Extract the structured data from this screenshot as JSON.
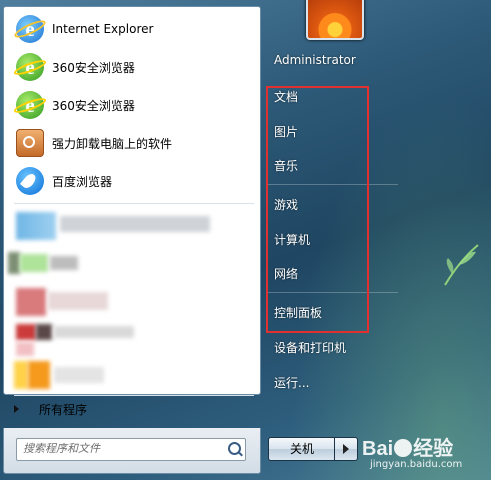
{
  "left_panel": {
    "pinned": [
      {
        "label": "Internet Explorer",
        "icon": "internet-explorer-icon"
      },
      {
        "label": "360安全浏览器",
        "icon": "360-browser-icon"
      },
      {
        "label": "360安全浏览器",
        "icon": "360-browser-icon"
      },
      {
        "label": "强力卸载电脑上的软件",
        "icon": "uninstaller-icon"
      },
      {
        "label": "百度浏览器",
        "icon": "baidu-browser-icon"
      }
    ],
    "all_programs": "所有程序",
    "search_placeholder": "搜索程序和文件"
  },
  "right_panel": {
    "user": "Administrator",
    "items": [
      "文档",
      "图片",
      "音乐",
      "游戏",
      "计算机",
      "网络",
      "控制面板",
      "设备和打印机",
      "运行..."
    ],
    "shutdown": "关机"
  },
  "watermark": {
    "brand": "Bai",
    "brand2": "经验",
    "url": "jingyan.baidu.com"
  },
  "colors": {
    "highlight_box": "#e03030"
  }
}
